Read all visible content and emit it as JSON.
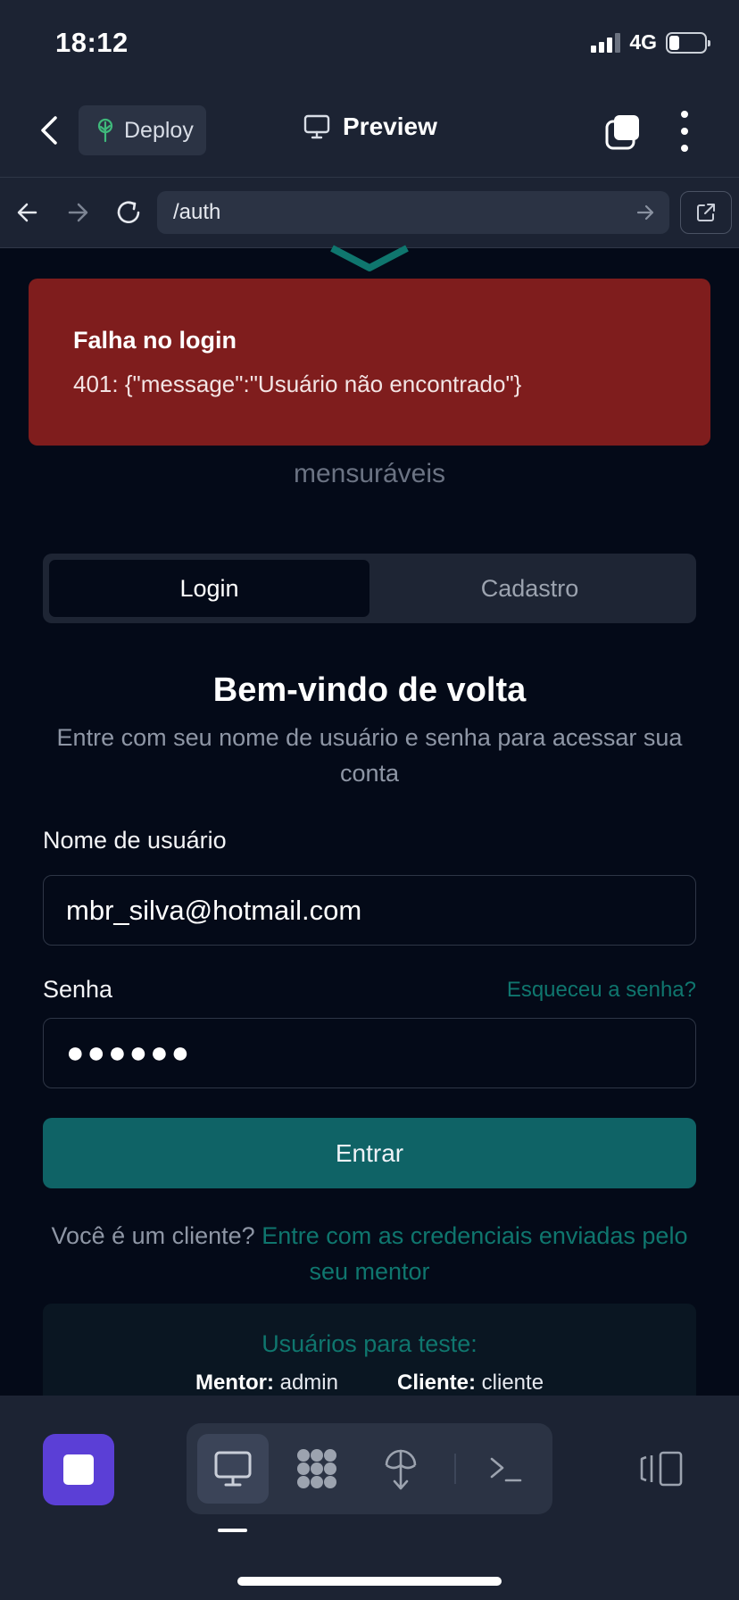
{
  "status": {
    "time": "18:12",
    "network": "4G"
  },
  "toolbar": {
    "deploy_label": "Deploy",
    "preview_label": "Preview"
  },
  "browser": {
    "url": "/auth"
  },
  "error": {
    "title": "Falha no login",
    "message": "401: {\"message\":\"Usuário não encontrado\"}"
  },
  "page": {
    "tagline": "mensuráveis",
    "tabs": [
      {
        "label": "Login",
        "active": true
      },
      {
        "label": "Cadastro",
        "active": false
      }
    ],
    "heading": "Bem-vindo de volta",
    "subheading": "Entre com seu nome de usuário e senha para acessar sua conta",
    "username": {
      "label": "Nome de usuário",
      "value": "mbr_silva@hotmail.com"
    },
    "password": {
      "label": "Senha",
      "value": "●●●●●●",
      "forgot_label": "Esqueceu a senha?"
    },
    "submit_label": "Entrar",
    "client_prompt": "Você é um cliente?",
    "client_link": "Entre com as credenciais enviadas pelo seu mentor",
    "test_users": {
      "title": "Usuários para teste:",
      "mentor_label": "Mentor:",
      "mentor_value": "admin",
      "client_label": "Cliente:",
      "client_value": "cliente"
    }
  },
  "colors": {
    "accent": "#0f766e",
    "error_bg": "#7f1d1d",
    "stop_button": "#5b3fd6",
    "submit_bg": "#0f6366"
  }
}
